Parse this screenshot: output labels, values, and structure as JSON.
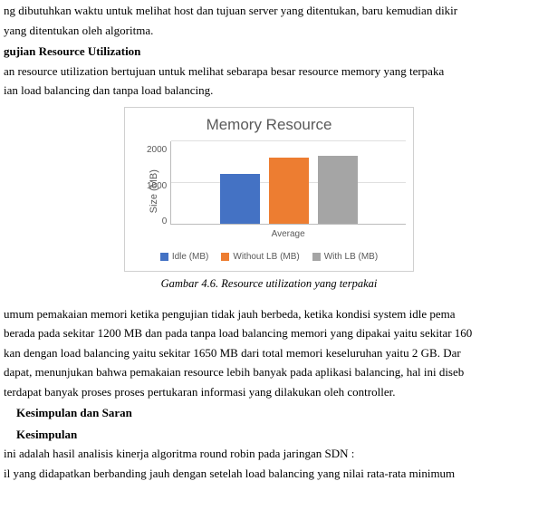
{
  "text": {
    "p1": "ng dibutuhkan waktu untuk melihat host dan tujuan server yang ditentukan, baru kemudian dikir",
    "p2": "yang ditentukan oleh algoritma.",
    "section1": "gujian Resource Utilization",
    "p3": "an resource utilization bertujuan untuk melihat sebarapa besar resource memory yang terpaka",
    "p4": "ian load balancing dan tanpa load balancing.",
    "caption": "Gambar 4.6. Resource utilization yang terpakai",
    "p5": "umum pemakaian memori ketika pengujian tidak jauh berbeda, ketika kondisi system idle pema",
    "p6": " berada pada sekitar 1200 MB dan pada tanpa load balancing memori yang dipakai yaitu sekitar 160",
    "p7": "kan dengan load balancing yaitu sekitar 1650 MB dari total memori keseluruhan yaitu 2 GB. Dar",
    "p8": " dapat, menunjukan bahwa pemakaian resource lebih banyak pada aplikasi balancing, hal ini diseb",
    "p9": "terdapat banyak proses proses pertukaran informasi yang dilakukan oleh controller.",
    "section2": "Kesimpulan dan Saran",
    "section3": "Kesimpulan",
    "p10": " ini adalah hasil analisis kinerja algoritma round robin pada jaringan SDN :",
    "p11": "il yang didapatkan berbanding jauh dengan setelah load balancing yang nilai rata-rata minimum"
  },
  "chart_data": {
    "type": "bar",
    "title": "Memory Resource",
    "ylabel": "Size (MB)",
    "xlabel": "Average",
    "categories": [
      "Average"
    ],
    "series": [
      {
        "name": "Idle (MB)",
        "values": [
          1200
        ],
        "color": "#4472C4"
      },
      {
        "name": "Without LB (MB)",
        "values": [
          1600
        ],
        "color": "#ED7D31"
      },
      {
        "name": "With LB (MB)",
        "values": [
          1650
        ],
        "color": "#A5A5A5"
      }
    ],
    "yticks": [
      0,
      1000,
      2000
    ],
    "ylim": [
      0,
      2000
    ]
  }
}
